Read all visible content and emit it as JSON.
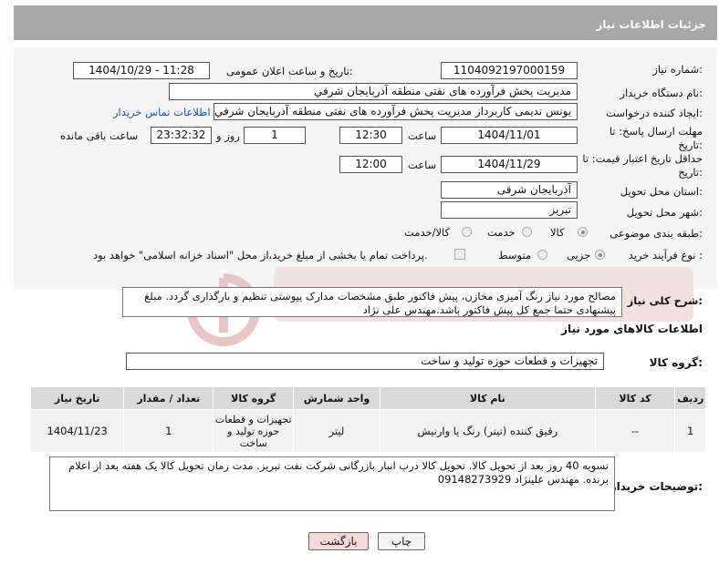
{
  "header": {
    "title": "جزئیات اطلاعات نیاز"
  },
  "form": {
    "need_number_label": "شماره نیاز:",
    "need_number": "1104092197000159",
    "announce_label": "تاریخ و ساعت اعلان عمومی:",
    "announce_value": "1404/10/29 - 11:28",
    "buyer_org_label": "نام دستگاه خریدار:",
    "buyer_org": "مدیریت پخش فرآورده های نفتی منطقه آذربایجان شرقي",
    "creator_label": "ایجاد کننده درخواست:",
    "creator": "یونس ندیمی کاربرداز مدیریت پخش فرآورده های نفتی منطقه آذربایجان شرقي",
    "contact_link": "اطلاعات تماس خریدار",
    "deadline_label": "مهلت ارسال پاسخ: تا تاریخ:",
    "deadline_date": "1404/11/01",
    "time_label": "ساعت",
    "deadline_time": "12:30",
    "days_value": "1",
    "days_label": "روز و",
    "remaining_value": "23:32:32",
    "remaining_label": "ساعت باقی مانده",
    "validity_label": "حداقل تاریخ اعتبار قیمت: تا تاریخ:",
    "validity_date": "1404/11/29",
    "validity_time": "12:00",
    "province_label": "استان محل تحویل:",
    "province": "آذربایجان شرقی",
    "city_label": "شهر محل تحویل:",
    "city": "تبریز",
    "category_label": "طبقه بندی موضوعی:",
    "category_options": [
      "کالا",
      "خدمت",
      "کالا/خدمت"
    ],
    "process_label": "نوع فرآیند خرید :",
    "process_options": [
      "جزیی",
      "متوسط"
    ],
    "payment_note": "پرداخت تمام یا بخشی از مبلغ خرید،از محل \"اسناد خزانه اسلامی\" خواهد بود."
  },
  "description": {
    "label": "شرح کلی نیاز:",
    "text": "مصالح مورد نیاز رنگ آمیزی مخازن، پیش فاکتور طبق مشخصات مدارک پیوستی تنظیم و بارگذاری گردد. مبلغ پیشنهادی حتما جمع کل پیش فاکتور باشد.مهندس علی نژاد"
  },
  "goods": {
    "section_title": "اطلاعات کالاهای مورد نیاز",
    "group_label": "گروه کالا:",
    "group_value": "تجهیزات و قطعات حوزه تولید و ساخت"
  },
  "table": {
    "headers": [
      "ردیف",
      "کد کالا",
      "نام کالا",
      "واحد شمارش",
      "گروه کالا",
      "تعداد / مقدار",
      "تاریخ نیاز"
    ],
    "rows": [
      {
        "row": "1",
        "code": "--",
        "name": "رقیق کننده (تینر) رنگ یا وارنیش",
        "unit": "لیتر",
        "group": "تجهیزات و قطعات حوزه تولید و ساخت",
        "qty": "1",
        "date": "1404/11/23"
      }
    ]
  },
  "buyer_notes": {
    "label": "توضیحات خریدار:",
    "text": "تسویه 40 روز بعد از تحویل کالا. تحویل کالا درب انبار بازرگانی شرکت نفت تبریز. مدت زمان تحویل کالا یک هفته بعد از اعلام برنده. مهندس علینژاد  09148273929"
  },
  "buttons": {
    "print": "چاپ",
    "back": "بازگشت"
  },
  "colors": {
    "header_bg": "#a8a8a8",
    "link": "#1a56a6",
    "back_btn": "#f7d9d9"
  }
}
